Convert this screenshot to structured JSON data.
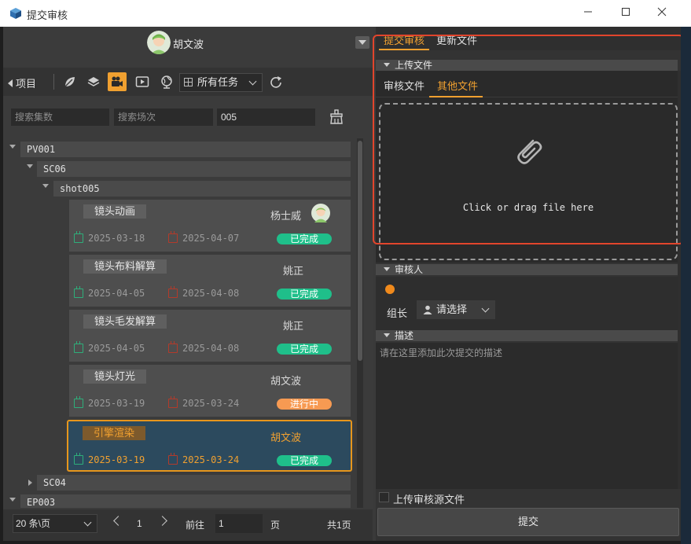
{
  "window": {
    "title": "提交审核",
    "controls": [
      "minimize",
      "maximize",
      "close"
    ]
  },
  "user": {
    "name": "胡文波"
  },
  "toolbar": {
    "project_label": "项目",
    "filter_select": "所有任务"
  },
  "search": {
    "episodes_placeholder": "搜索集数",
    "scenes_placeholder": "搜索场次",
    "shots_value": "005"
  },
  "tree": {
    "nodes": [
      {
        "label": "PV001",
        "expanded": true
      },
      {
        "label": "SC06",
        "expanded": true
      },
      {
        "label": "shot005",
        "expanded": true
      },
      {
        "label": "SC04",
        "expanded": false
      },
      {
        "label": "EP003",
        "expanded": true
      }
    ]
  },
  "tasks": [
    {
      "name": "镜头动画",
      "assignee": "杨士威",
      "start": "2025-03-18",
      "end": "2025-04-07",
      "status": "已完成",
      "status_color": "#1fbf8a",
      "has_avatar": true,
      "selected": false
    },
    {
      "name": "镜头布料解算",
      "assignee": "姚正",
      "start": "2025-04-05",
      "end": "2025-04-08",
      "status": "已完成",
      "status_color": "#1fbf8a",
      "has_avatar": false,
      "selected": false
    },
    {
      "name": "镜头毛发解算",
      "assignee": "姚正",
      "start": "2025-04-05",
      "end": "2025-04-08",
      "status": "已完成",
      "status_color": "#1fbf8a",
      "has_avatar": false,
      "selected": false
    },
    {
      "name": "镜头灯光",
      "assignee": "胡文波",
      "start": "2025-03-19",
      "end": "2025-03-24",
      "status": "进行中",
      "status_color": "#f79a52",
      "has_avatar": false,
      "selected": false
    },
    {
      "name": "引擎渲染",
      "assignee": "胡文波",
      "start": "2025-03-19",
      "end": "2025-03-24",
      "status": "已完成",
      "status_color": "#1fbf8a",
      "has_avatar": false,
      "selected": true
    }
  ],
  "pager": {
    "page_size": "20 条\\页",
    "current_page": "1",
    "goto_label": "前往",
    "goto_value": "1",
    "page_unit": "页",
    "total": "共1页"
  },
  "right": {
    "tabs": [
      {
        "label": "提交审核",
        "active": true
      },
      {
        "label": "更新文件",
        "active": false
      }
    ],
    "upload_section": "上传文件",
    "upload_tabs": [
      {
        "label": "审核文件",
        "active": false
      },
      {
        "label": "其他文件",
        "active": true
      }
    ],
    "dropzone_text": "Click or drag file here",
    "reviewer_section": "审核人",
    "leader_label": "组长",
    "leader_select": "请选择",
    "description_section": "描述",
    "description_placeholder": "请在这里添加此次提交的描述",
    "upload_source_label": "上传审核源文件",
    "submit_label": "提交"
  },
  "colors": {
    "accent": "#f0a030",
    "highlight_border": "#e2452c",
    "done": "#1fbf8a",
    "in_progress": "#f79a52"
  }
}
